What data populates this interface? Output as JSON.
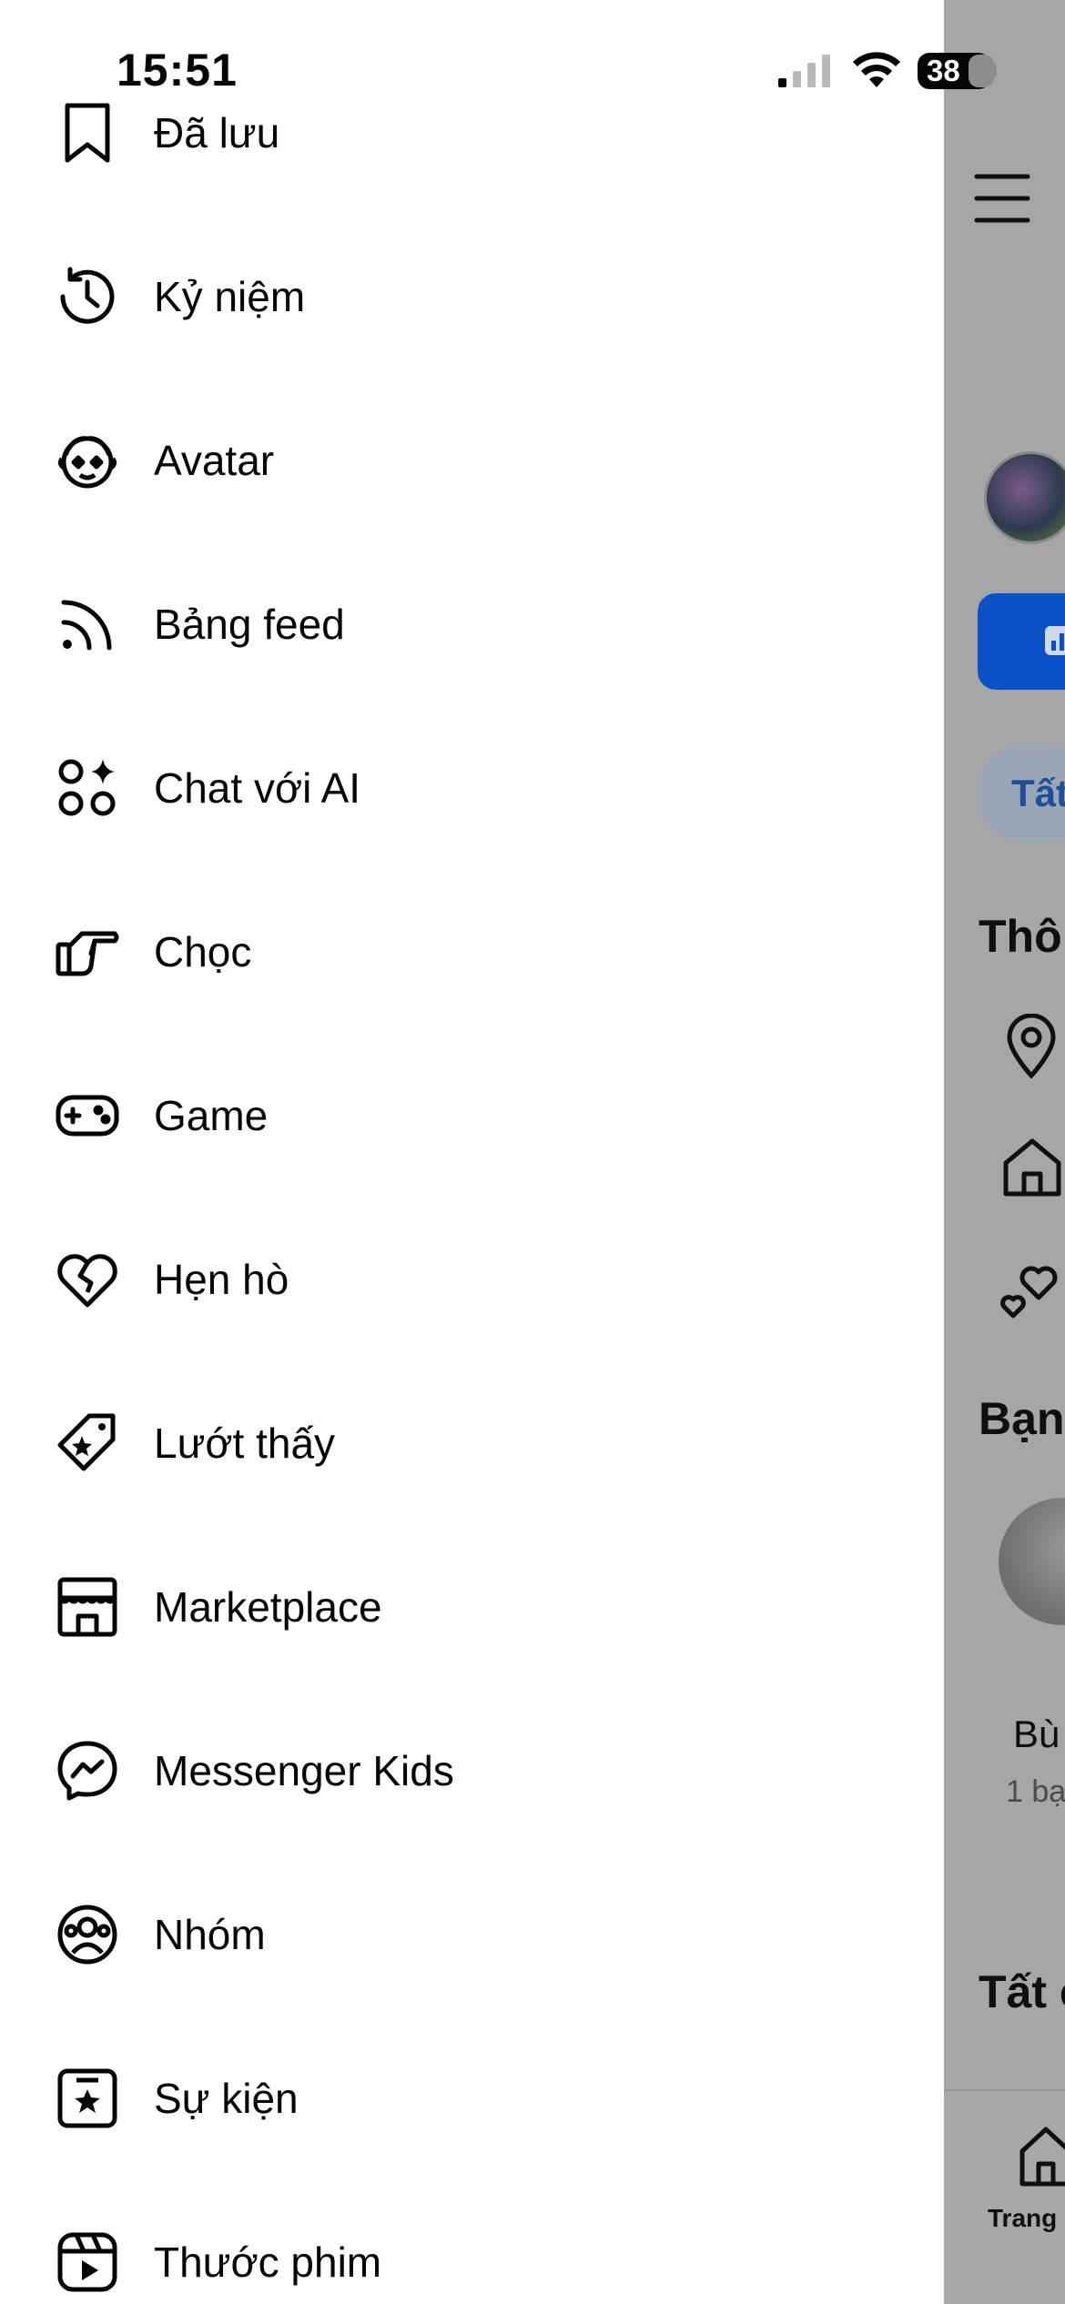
{
  "status_bar": {
    "time": "15:51",
    "battery": "38"
  },
  "menu": {
    "items": [
      {
        "label": "Đã lưu",
        "icon": "bookmark-icon"
      },
      {
        "label": "Kỷ niệm",
        "icon": "memories-clock-icon"
      },
      {
        "label": "Avatar",
        "icon": "avatar-face-icon"
      },
      {
        "label": "Bảng feed",
        "icon": "feed-rss-icon"
      },
      {
        "label": "Chat với AI",
        "icon": "ai-chat-sparkle-icon"
      },
      {
        "label": "Chọc",
        "icon": "poke-hand-icon"
      },
      {
        "label": "Game",
        "icon": "gamepad-icon"
      },
      {
        "label": "Hẹn hò",
        "icon": "dating-heart-icon"
      },
      {
        "label": "Lướt thấy",
        "icon": "deals-tag-icon"
      },
      {
        "label": "Marketplace",
        "icon": "marketplace-store-icon"
      },
      {
        "label": "Messenger Kids",
        "icon": "messenger-icon"
      },
      {
        "label": "Nhóm",
        "icon": "groups-icon"
      },
      {
        "label": "Sự kiện",
        "icon": "events-star-icon"
      },
      {
        "label": "Thước phim",
        "icon": "reels-play-icon"
      }
    ]
  },
  "background_page": {
    "tab_all": "Tất",
    "section_info": "Thô",
    "section_friends": "Bạn",
    "friend_name": "Bù",
    "friend_sub": "1 bạ",
    "section_all": "Tất c",
    "nav_home": "Trang"
  }
}
